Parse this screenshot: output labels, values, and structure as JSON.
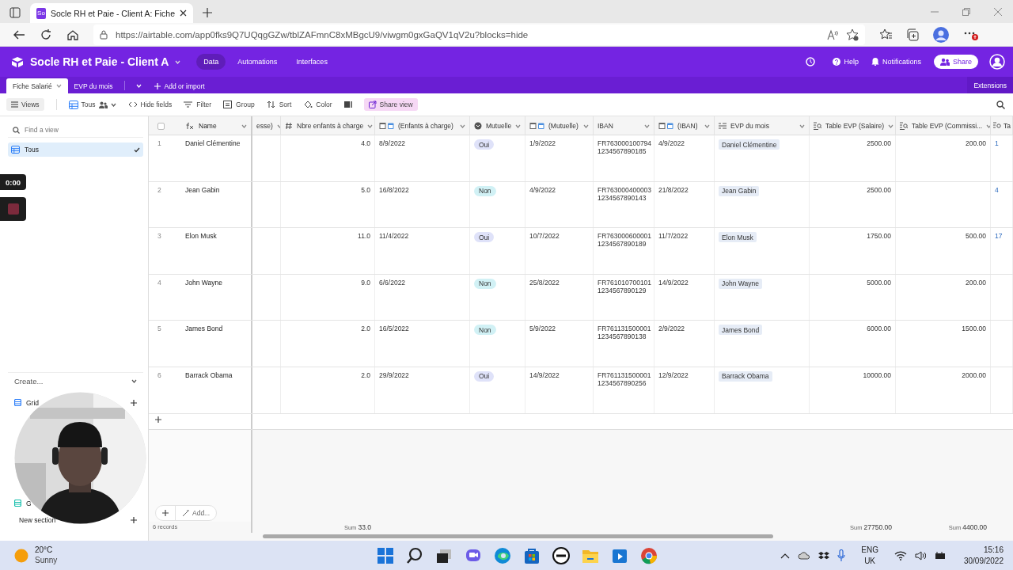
{
  "browser": {
    "tab_title": "Socle RH et Paie - Client A: Fiche",
    "favicon": "So",
    "url": "https://airtable.com/app0fks9Q7UQqgGZw/tblZAFmnC8xMBgcU9/viwgm0gxGaQV1qV2u?blocks=hide"
  },
  "header": {
    "base_title": "Socle RH et Paie - Client A",
    "nav": [
      {
        "label": "Data",
        "selected": true
      },
      {
        "label": "Automations",
        "selected": false
      },
      {
        "label": "Interfaces",
        "selected": false
      }
    ],
    "actions": [
      {
        "label": "Help",
        "kind": "help"
      },
      {
        "label": "Notifications",
        "kind": "bell"
      }
    ],
    "share": "Share"
  },
  "tables": {
    "tabs": [
      {
        "label": "Fiche Salarié",
        "selected": true
      },
      {
        "label": "EVP du mois",
        "selected": false
      }
    ],
    "add": "Add or import",
    "extensions": "Extensions"
  },
  "toolbar": {
    "views": "Views",
    "view_name": "Tous",
    "items": [
      {
        "label": "Hide fields",
        "kind": "hide"
      },
      {
        "label": "Filter",
        "kind": "filter"
      },
      {
        "label": "Group",
        "kind": "group"
      },
      {
        "label": "Sort",
        "kind": "sort"
      },
      {
        "label": "Color",
        "kind": "color"
      }
    ],
    "share_view": "Share view"
  },
  "sidebar": {
    "search": {
      "placeholder": "Find a view"
    },
    "views": [
      {
        "label": "Tous",
        "selected": true
      }
    ],
    "create_title": "Create...",
    "create_items": [
      {
        "label": "Grid",
        "color": "#2d7ff9",
        "addable": true
      },
      {
        "label": "G",
        "color": "#18bfad",
        "addable": false
      }
    ],
    "new_section": "New section"
  },
  "recorder": {
    "timer": "0:00"
  },
  "grid": {
    "select_all": {
      "checked": false
    },
    "name_header": "Name",
    "columns": [
      {
        "label": "esse)",
        "kind": "text"
      },
      {
        "label": "Nbre enfants à charge",
        "kind": "number",
        "summary": {
          "label": "Sum",
          "value": "33.0"
        }
      },
      {
        "label": "(Enfants à charge)",
        "kind": "date"
      },
      {
        "label": "Mutuelle",
        "kind": "select"
      },
      {
        "label": "(Mutuelle)",
        "kind": "date"
      },
      {
        "label": "IBAN",
        "kind": "text"
      },
      {
        "label": "(IBAN)",
        "kind": "date"
      },
      {
        "label": "EVP du mois",
        "kind": "link"
      },
      {
        "label": "Table EVP (Salaire)",
        "kind": "lookup",
        "summary": {
          "label": "Sum",
          "value": "27750.00"
        }
      },
      {
        "label": "Table EVP (Commissi...",
        "kind": "lookup",
        "summary": {
          "label": "Sum",
          "value": "4400.00"
        }
      },
      {
        "label": "Ta",
        "kind": "rollup"
      }
    ],
    "rows": [
      {
        "num": "1",
        "name": "Daniel Clémentine",
        "cells": [
          null,
          "4.0",
          "8/9/2022",
          {
            "label": "Oui",
            "color": "#dfe2f9"
          },
          "1/9/2022",
          "FR763000100794 1234567890185",
          "4/9/2022",
          "Daniel Clémentine",
          "2500.00",
          "200.00",
          "1"
        ]
      },
      {
        "num": "2",
        "name": "Jean Gabin",
        "cells": [
          null,
          "5.0",
          "16/8/2022",
          {
            "label": "Non",
            "color": "#d1f1f5"
          },
          "4/9/2022",
          "FR763000400003 1234567890143",
          "21/8/2022",
          "Jean Gabin",
          "2500.00",
          null,
          "4"
        ]
      },
      {
        "num": "3",
        "name": "Elon Musk",
        "cells": [
          null,
          "11.0",
          "11/4/2022",
          {
            "label": "Oui",
            "color": "#dfe2f9"
          },
          "10/7/2022",
          "FR763000600001 1234567890189",
          "11/7/2022",
          "Elon Musk",
          "1750.00",
          "500.00",
          "17"
        ]
      },
      {
        "num": "4",
        "name": "John Wayne",
        "cells": [
          null,
          "9.0",
          "6/6/2022",
          {
            "label": "Non",
            "color": "#d1f1f5"
          },
          "25/8/2022",
          "FR761010700101 1234567890129",
          "14/9/2022",
          "John Wayne",
          "5000.00",
          "200.00",
          null
        ]
      },
      {
        "num": "5",
        "name": "James Bond",
        "cells": [
          null,
          "2.0",
          "16/5/2022",
          {
            "label": "Non",
            "color": "#d1f1f5"
          },
          "5/9/2022",
          "FR761131500001 1234567890138",
          "2/9/2022",
          "James Bond",
          "6000.00",
          "1500.00",
          null
        ]
      },
      {
        "num": "6",
        "name": "Barrack Obama",
        "cells": [
          null,
          "2.0",
          "29/9/2022",
          {
            "label": "Oui",
            "color": "#dfe2f9"
          },
          "14/9/2022",
          "FR761131500001 1234567890256",
          "12/9/2022",
          "Barrack Obama",
          "10000.00",
          "2000.00",
          null
        ]
      }
    ],
    "add_label": "Add...",
    "records": "6 records"
  },
  "taskbar": {
    "weather": {
      "temp": "20°C",
      "condition": "Sunny"
    },
    "apps": [
      {
        "kind": "start"
      },
      {
        "kind": "search"
      },
      {
        "kind": "taskview"
      },
      {
        "kind": "chat"
      },
      {
        "kind": "edge"
      },
      {
        "kind": "store"
      },
      {
        "kind": "dell"
      },
      {
        "kind": "files"
      },
      {
        "kind": "media"
      },
      {
        "kind": "chrome"
      }
    ],
    "language": [
      "ENG",
      "UK"
    ],
    "time": "15:16",
    "date": "30/09/2022"
  }
}
